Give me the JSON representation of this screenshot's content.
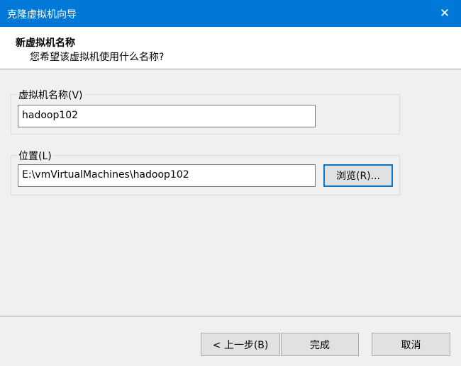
{
  "window": {
    "title": "克隆虚拟机向导",
    "close_symbol": "✕"
  },
  "header": {
    "title": "新虚拟机名称",
    "subtitle": "您希望该虚拟机使用什么名称?"
  },
  "name_group": {
    "label": "虚拟机名称(V)",
    "value": "hadoop102"
  },
  "location_group": {
    "label": "位置(L)",
    "value": "E:\\vmVirtualMachines\\hadoop102",
    "browse_label": "浏览(R)..."
  },
  "footer": {
    "back_label": "< 上一步(B)",
    "finish_label": "完成",
    "cancel_label": "取消"
  }
}
